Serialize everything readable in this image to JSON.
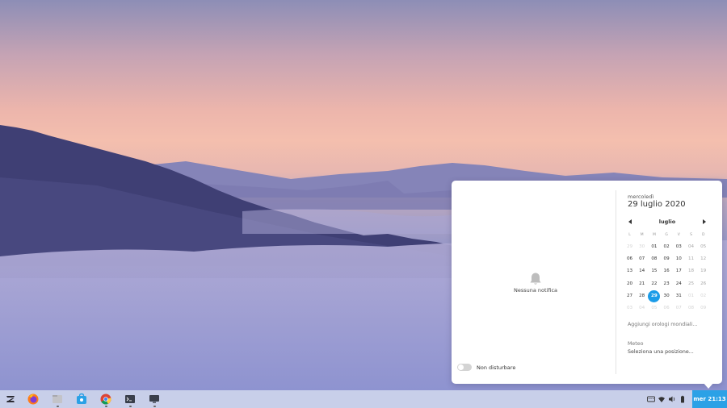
{
  "notifications": {
    "empty_text": "Nessuna notifica",
    "dnd_label": "Non disturbare"
  },
  "calendar": {
    "weekday": "mercoledì",
    "full_date": "29 luglio 2020",
    "month": "luglio",
    "day_headers": [
      "L",
      "M",
      "M",
      "G",
      "V",
      "S",
      "D"
    ],
    "weeks": [
      [
        "29",
        "30",
        "01",
        "02",
        "03",
        "04",
        "05"
      ],
      [
        "06",
        "07",
        "08",
        "09",
        "10",
        "11",
        "12"
      ],
      [
        "13",
        "14",
        "15",
        "16",
        "17",
        "18",
        "19"
      ],
      [
        "20",
        "21",
        "22",
        "23",
        "24",
        "25",
        "26"
      ],
      [
        "27",
        "28",
        "29",
        "30",
        "31",
        "01",
        "02"
      ],
      [
        "03",
        "04",
        "05",
        "06",
        "07",
        "08",
        "09"
      ]
    ],
    "today": "29",
    "add_clocks": "Aggiungi orologi mondiali...",
    "meteo_label": "Meteo",
    "meteo_link": "Seleziona una posizione..."
  },
  "taskbar": {
    "apps": [
      {
        "name": "zorin-menu-icon",
        "running": false
      },
      {
        "name": "firefox-icon",
        "running": false
      },
      {
        "name": "files-icon",
        "running": true
      },
      {
        "name": "software-store-icon",
        "running": false
      },
      {
        "name": "chrome-icon",
        "running": true
      },
      {
        "name": "terminal-icon",
        "running": true
      },
      {
        "name": "screen-icon",
        "running": true
      }
    ],
    "tray": [
      "keyboard-layout-icon",
      "wifi-icon",
      "volume-icon",
      "battery-icon"
    ],
    "clock": "mer 21:13"
  },
  "colors": {
    "accent": "#2ba1e6",
    "today": "#1c9ce8"
  }
}
